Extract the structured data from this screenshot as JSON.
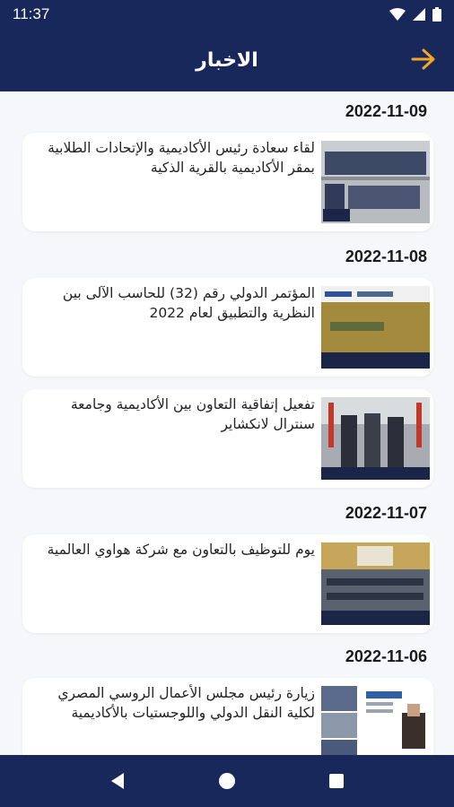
{
  "status_bar": {
    "time": "11:37",
    "icons": [
      "wifi-icon",
      "signal-icon",
      "battery-icon"
    ]
  },
  "app_bar": {
    "title": "الاخبار",
    "back_icon": "arrow-right-icon",
    "accent_color": "#f5a623",
    "background": "#19285a"
  },
  "news": {
    "groups": [
      {
        "date": "2022-11-09",
        "items": [
          {
            "title": "لقاء سعادة رئيس الأكاديمية والإتحادات الطلابية بمقر الأكاديمية بالقرية الذكية",
            "image": "group-photo"
          }
        ]
      },
      {
        "date": "2022-11-08",
        "items": [
          {
            "title": "المؤتمر الدولي رقم (32) للحاسب الآلى بين النظرية والتطبيق لعام 2022",
            "image": "conference-poster"
          },
          {
            "title": "تفعيل إتفاقية التعاون بين الأكاديمية وجامعة سنترال لانكشاير",
            "image": "agreement-photo"
          }
        ]
      },
      {
        "date": "2022-11-07",
        "items": [
          {
            "title": "يوم للتوظيف بالتعاون مع شركة هواوي العالمية",
            "image": "auditorium-photo"
          }
        ]
      },
      {
        "date": "2022-11-06",
        "items": [
          {
            "title": "زيارة رئيس مجلس الأعمال الروسي المصري لكلية النقل الدولي واللوجستيات بالأكاديمية",
            "image": "visit-collage"
          }
        ]
      }
    ]
  },
  "nav_bar": {
    "back": "nav-back-icon",
    "home": "nav-home-icon",
    "recents": "nav-recents-icon"
  }
}
